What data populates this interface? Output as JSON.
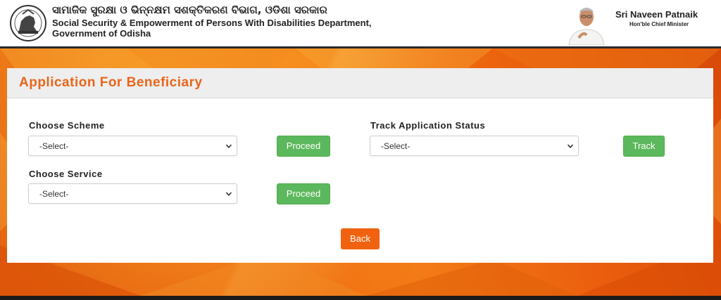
{
  "header": {
    "dept_odia": "ସାମାଜିକ ସୁରକ୍ଷା ଓ ଭିନ୍ନକ୍ଷମ ସଶକ୍ତିକରଣ ବିଭାଗ, ଓଡିଶା ସରକାର",
    "dept_english_line1": "Social Security & Empowerment of Persons With Disabilities Department,",
    "dept_english_line2": "Government of Odisha",
    "cm_name": "Sri Naveen Patnaik",
    "cm_title": "Hon'ble Chief Minister"
  },
  "card": {
    "title": "Application For Beneficiary",
    "choose_scheme": {
      "label": "Choose Scheme",
      "selected": "-Select-",
      "button": "Proceed"
    },
    "choose_service": {
      "label": "Choose Service",
      "selected": "-Select-",
      "button": "Proceed"
    },
    "track_status": {
      "label": "Track Application Status",
      "selected": "-Select-",
      "button": "Track"
    },
    "back_button": "Back"
  },
  "colors": {
    "accent_orange": "#e9661a",
    "button_green": "#5cb85c",
    "back_orange": "#f0620f"
  }
}
